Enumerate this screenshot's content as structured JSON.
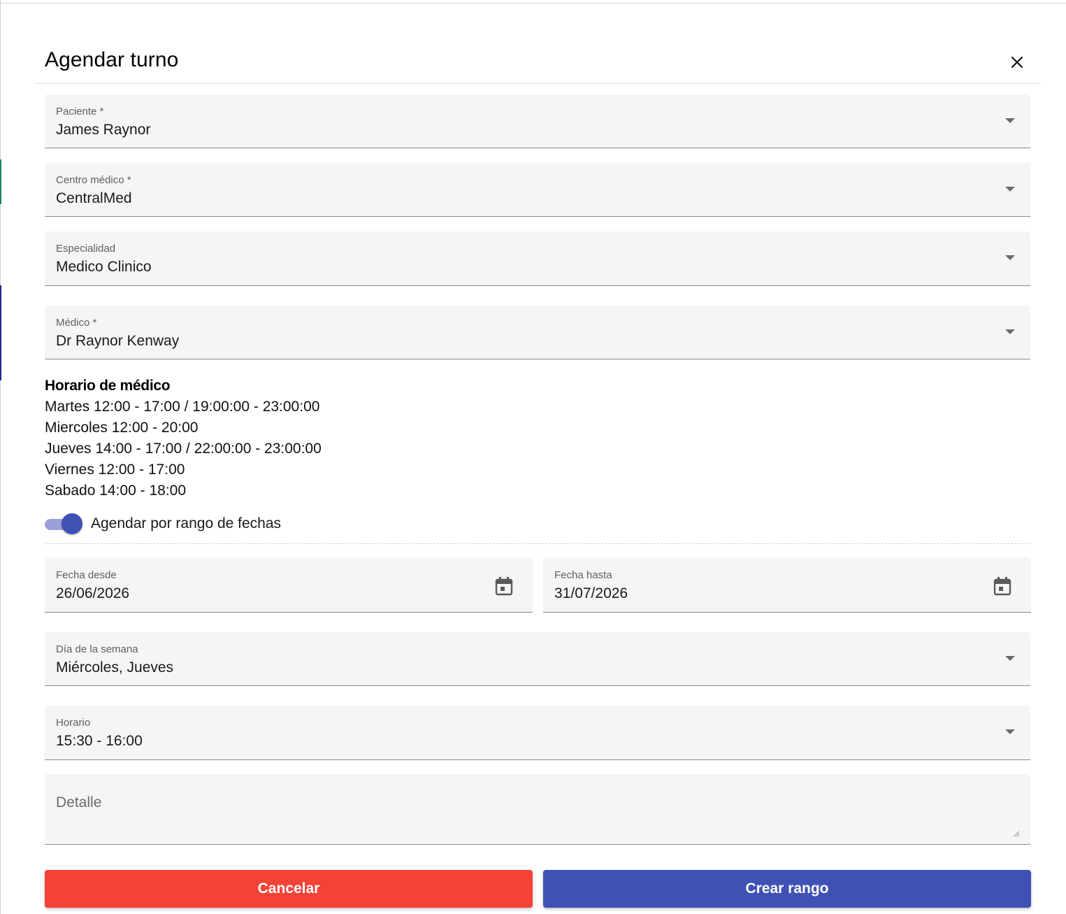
{
  "dialog": {
    "title": "Agendar turno"
  },
  "form": {
    "paciente": {
      "label": "Paciente *",
      "value": "James Raynor"
    },
    "centro": {
      "label": "Centro médico *",
      "value": "CentralMed"
    },
    "especialidad": {
      "label": "Especialidad",
      "value": "Medico Clinico"
    },
    "medico": {
      "label": "Médico *",
      "value": "Dr Raynor Kenway"
    },
    "fecha_desde": {
      "label": "Fecha desde",
      "value": "26/06/2026"
    },
    "fecha_hasta": {
      "label": "Fecha hasta",
      "value": "31/07/2026"
    },
    "dia_semana": {
      "label": "Día de la semana",
      "value": "Miércoles, Jueves"
    },
    "horario": {
      "label": "Horario",
      "value": "15:30 - 16:00"
    },
    "detalle": {
      "placeholder": "Detalle"
    }
  },
  "schedule": {
    "heading": "Horario de médico",
    "lines": [
      "Martes 12:00 - 17:00 / 19:00:00 - 23:00:00",
      "Miercoles 12:00 - 20:00",
      "Jueves 14:00 - 17:00 / 22:00:00 - 23:00:00",
      "Viernes 12:00 - 17:00",
      "Sabado 14:00 - 18:00"
    ]
  },
  "toggle": {
    "label": "Agendar por rango de fechas",
    "checked": true
  },
  "buttons": {
    "cancel": "Cancelar",
    "create": "Crear rango"
  },
  "colors": {
    "cancel": "#f44336",
    "primary": "#3f51b5",
    "toggle_track": "#9aa0d9",
    "field_bg": "#f5f5f5"
  },
  "icons": {
    "close": "close-icon",
    "dropdown": "dropdown-arrow-icon",
    "calendar": "calendar-icon"
  }
}
